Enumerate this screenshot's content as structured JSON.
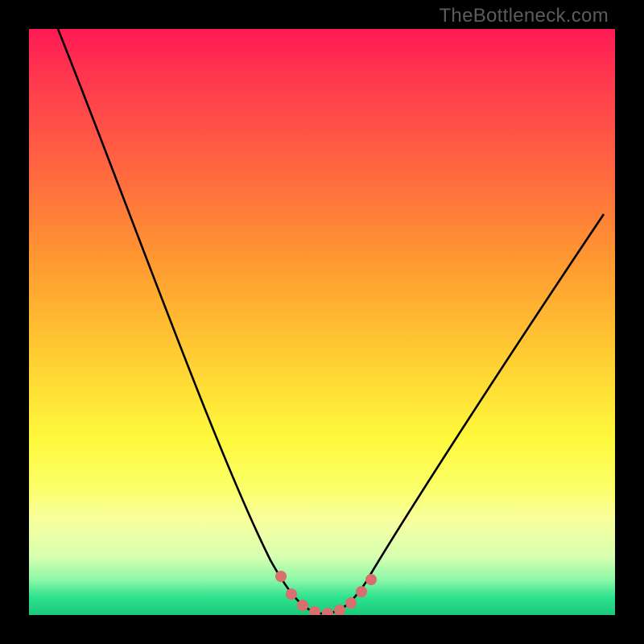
{
  "watermark": "TheBottleneck.com",
  "chart_data": {
    "type": "line",
    "title": "",
    "xlabel": "",
    "ylabel": "",
    "xlim": [
      0,
      100
    ],
    "ylim": [
      0,
      100
    ],
    "grid": false,
    "legend": false,
    "series": [
      {
        "name": "curve",
        "x": [
          5,
          10,
          15,
          20,
          25,
          30,
          35,
          40,
          43,
          46,
          48,
          50,
          52,
          55,
          58,
          62,
          68,
          75,
          82,
          90,
          98
        ],
        "y": [
          100,
          86,
          73,
          61,
          49,
          38,
          27,
          16,
          9,
          4,
          1,
          0,
          0,
          2,
          6,
          12,
          21,
          31,
          41,
          52,
          63
        ]
      }
    ],
    "markers": {
      "name": "highlight-dots",
      "color": "#d86e6e",
      "x": [
        43,
        45,
        47,
        49,
        51,
        53,
        55,
        57,
        58.5
      ],
      "y": [
        6.5,
        3.2,
        1.3,
        0.3,
        0.1,
        0.6,
        1.8,
        3.8,
        5.4
      ]
    }
  }
}
